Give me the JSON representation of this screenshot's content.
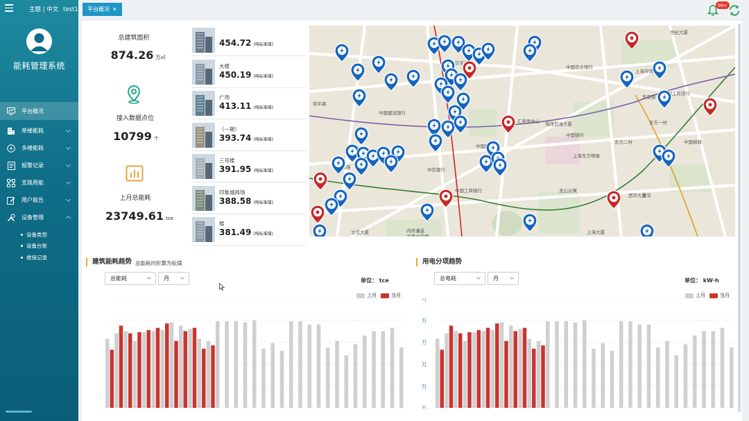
{
  "header": {
    "top_links": "主题 | 中文",
    "user": "test1",
    "app_title": "能耗管理系统",
    "tab_label": "平台概况",
    "badge": "99+"
  },
  "nav": {
    "items": [
      {
        "label": "平台概况",
        "icon": "monitor-icon"
      },
      {
        "label": "单楼能耗",
        "icon": "building-icon"
      },
      {
        "label": "多楼能耗",
        "icon": "lightning-icon"
      },
      {
        "label": "报警记录",
        "icon": "document-icon"
      },
      {
        "label": "支路用能",
        "icon": "network-icon"
      },
      {
        "label": "用户报告",
        "icon": "edit-icon"
      },
      {
        "label": "设备管理",
        "icon": "tools-icon"
      }
    ],
    "sub_items": [
      "设备类型",
      "设备台账",
      "维保记录"
    ]
  },
  "stats": {
    "area_label": "总建筑面积",
    "area_value": "874.26",
    "area_unit": "万㎡",
    "points_label": "接入数据点位",
    "points_value": "10799",
    "points_unit": "个",
    "energy_label": "上月总能耗",
    "energy_value": "23749.61",
    "energy_unit": "tce"
  },
  "ranking": [
    {
      "name": "",
      "value": "454.72",
      "unit": "(吨标准煤)"
    },
    {
      "name": "大楼",
      "value": "450.19",
      "unit": "(吨标准煤)"
    },
    {
      "name": "广场",
      "value": "413.11",
      "unit": "(吨标准煤)"
    },
    {
      "name": "（一期）",
      "value": "393.74",
      "unit": "(吨标准煤)"
    },
    {
      "name": "三号楼",
      "value": "391.95",
      "unit": "(吨标准煤)"
    },
    {
      "name": "印象城商场",
      "value": "388.58",
      "unit": "(吨标准煤)"
    },
    {
      "name": "楼",
      "value": "381.49",
      "unit": "(吨标准煤)"
    }
  ],
  "map": {
    "labels": [
      "中国建设银行",
      "中国农业银行",
      "上海市博物馆",
      "中国工商银行",
      "东安路",
      "中国银行",
      "汇商务中心",
      "海洋石油大厦",
      "中信银行",
      "中国工商银行",
      "上海东方明珠",
      "龙山公寓",
      "世纪大厦",
      "内环漕溪",
      "北路立交桥",
      "徐家汇",
      "宜山路",
      "东方二村",
      "中国邮政",
      "上海大厦",
      "立信大厦",
      "西华大厦",
      "延安东路",
      "龙华",
      "东方一村",
      "中国民生",
      "宛平路"
    ],
    "colors": {
      "marker_blue": "#1565c0",
      "marker_red": "#c62828"
    }
  },
  "chart_left": {
    "title": "建筑能耗趋势",
    "subtitle": "总能耗时折算为标煤",
    "select1": "总能耗",
    "select2": "月",
    "unit": "单位：  tce",
    "legend_prev": "上月",
    "legend_curr": "当月"
  },
  "chart_right": {
    "title": "用电分项趋势",
    "select1": "总电耗",
    "select2": "月",
    "unit": "单位：  kW·h",
    "legend_prev": "上月",
    "legend_curr": "当月",
    "y_tick": "万"
  },
  "chart_data": [
    {
      "type": "bar",
      "x": [
        1,
        2,
        3,
        4,
        5,
        6,
        7,
        8,
        9,
        10,
        11,
        12,
        13,
        14,
        15,
        16,
        17,
        18,
        19,
        20,
        21,
        22,
        23,
        24,
        25,
        26,
        27,
        28,
        29,
        30,
        31
      ],
      "series": [
        {
          "name": "上月",
          "values": [
            0.63,
            0.68,
            0.7,
            0.61,
            0.69,
            0.7,
            0.71,
            0.78,
            0.75,
            0.72,
            0.63,
            0.61,
            0.79,
            0.79,
            0.79,
            0.78,
            0.8,
            0.54,
            0.59,
            0.52,
            0.79,
            0.79,
            0.76,
            0.76,
            0.55,
            0.61,
            0.48,
            0.58,
            0.66,
            0.7,
            0.7,
            0.73,
            0.55
          ]
        },
        {
          "name": "当月",
          "values": [
            0.53,
            0.75,
            0.68,
            0.69,
            0.71,
            0.73,
            0.77,
            0.61,
            0.7,
            0.73,
            0.54,
            0.57
          ]
        }
      ],
      "colors": {
        "上月": "#cfcfcf",
        "当月": "#c9352f"
      }
    },
    {
      "type": "bar",
      "x": [
        1,
        2,
        3,
        4,
        5,
        6,
        7,
        8,
        9,
        10,
        11,
        12,
        13,
        14,
        15,
        16,
        17,
        18,
        19,
        20,
        21,
        22,
        23,
        24,
        25,
        26,
        27,
        28,
        29,
        30,
        31
      ],
      "series": [
        {
          "name": "上月",
          "values": [
            0.63,
            0.68,
            0.7,
            0.61,
            0.69,
            0.7,
            0.71,
            0.78,
            0.75,
            0.72,
            0.63,
            0.61,
            0.79,
            0.79,
            0.79,
            0.78,
            0.8,
            0.54,
            0.59,
            0.52,
            0.79,
            0.79,
            0.76,
            0.76,
            0.55,
            0.61,
            0.48,
            0.58,
            0.66,
            0.7,
            0.7,
            0.73,
            0.55
          ]
        },
        {
          "name": "当月",
          "values": [
            0.53,
            0.75,
            0.68,
            0.69,
            0.71,
            0.73,
            0.77,
            0.61,
            0.7,
            0.73,
            0.54,
            0.57
          ]
        }
      ],
      "colors": {
        "上月": "#cfcfcf",
        "当月": "#c9352f"
      }
    }
  ]
}
